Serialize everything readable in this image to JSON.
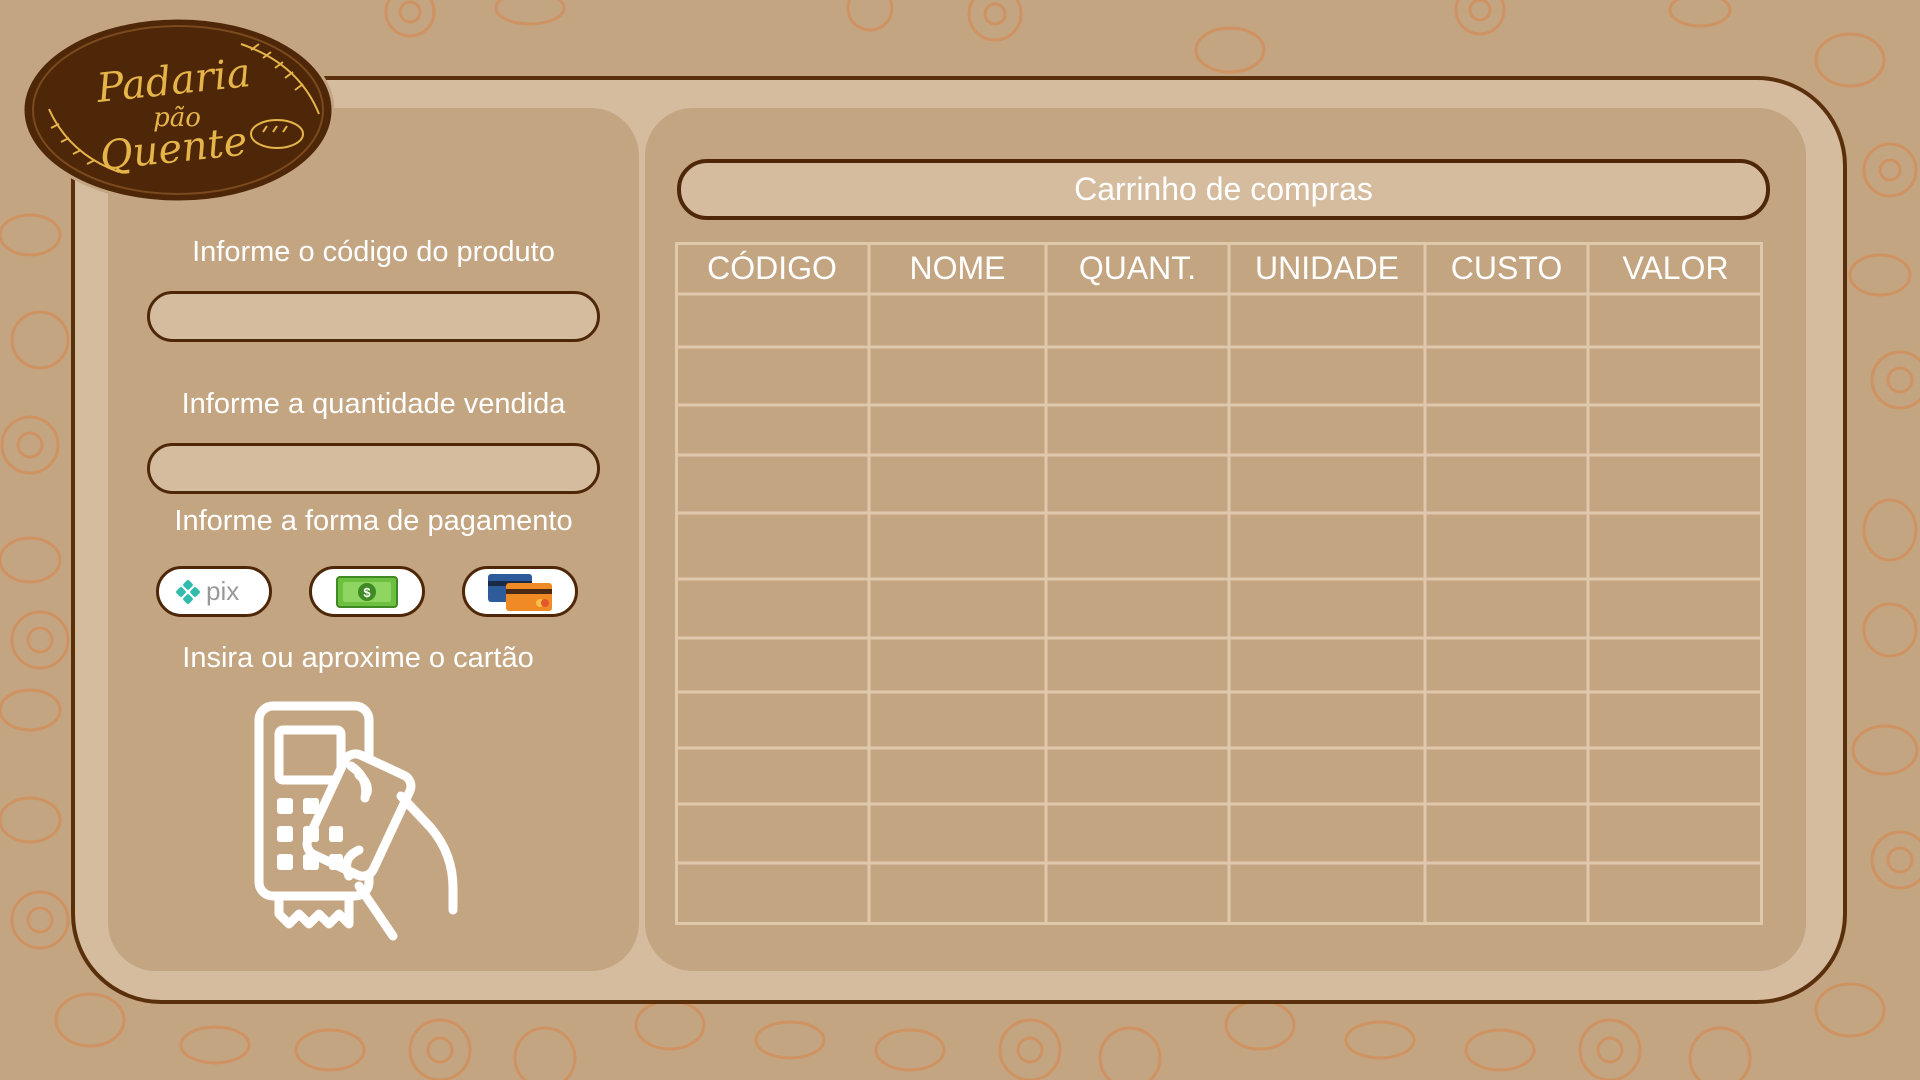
{
  "logo": {
    "line1": "Padaria",
    "line2": "pão",
    "line3": "Quente"
  },
  "form": {
    "product_code_label": "Informe o código do produto",
    "product_code_value": "",
    "quantity_label": "Informe a quantidade vendida",
    "quantity_value": "",
    "payment_label": "Informe a forma de pagamento",
    "payment_options": [
      "pix",
      "cash",
      "card"
    ],
    "pix_text": "pix",
    "card_prompt": "Insira ou aproxime o cartão"
  },
  "cart": {
    "title": "Carrinho de compras",
    "columns": [
      "CÓDIGO",
      "NOME",
      "QUANT.",
      "UNIDADE",
      "CUSTO",
      "VALOR"
    ],
    "rows": []
  },
  "colors": {
    "background": "#c4a582",
    "frame": "#d5bc9e",
    "border": "#4e2708",
    "text": "#ffffff",
    "pattern": "#d9783a"
  }
}
